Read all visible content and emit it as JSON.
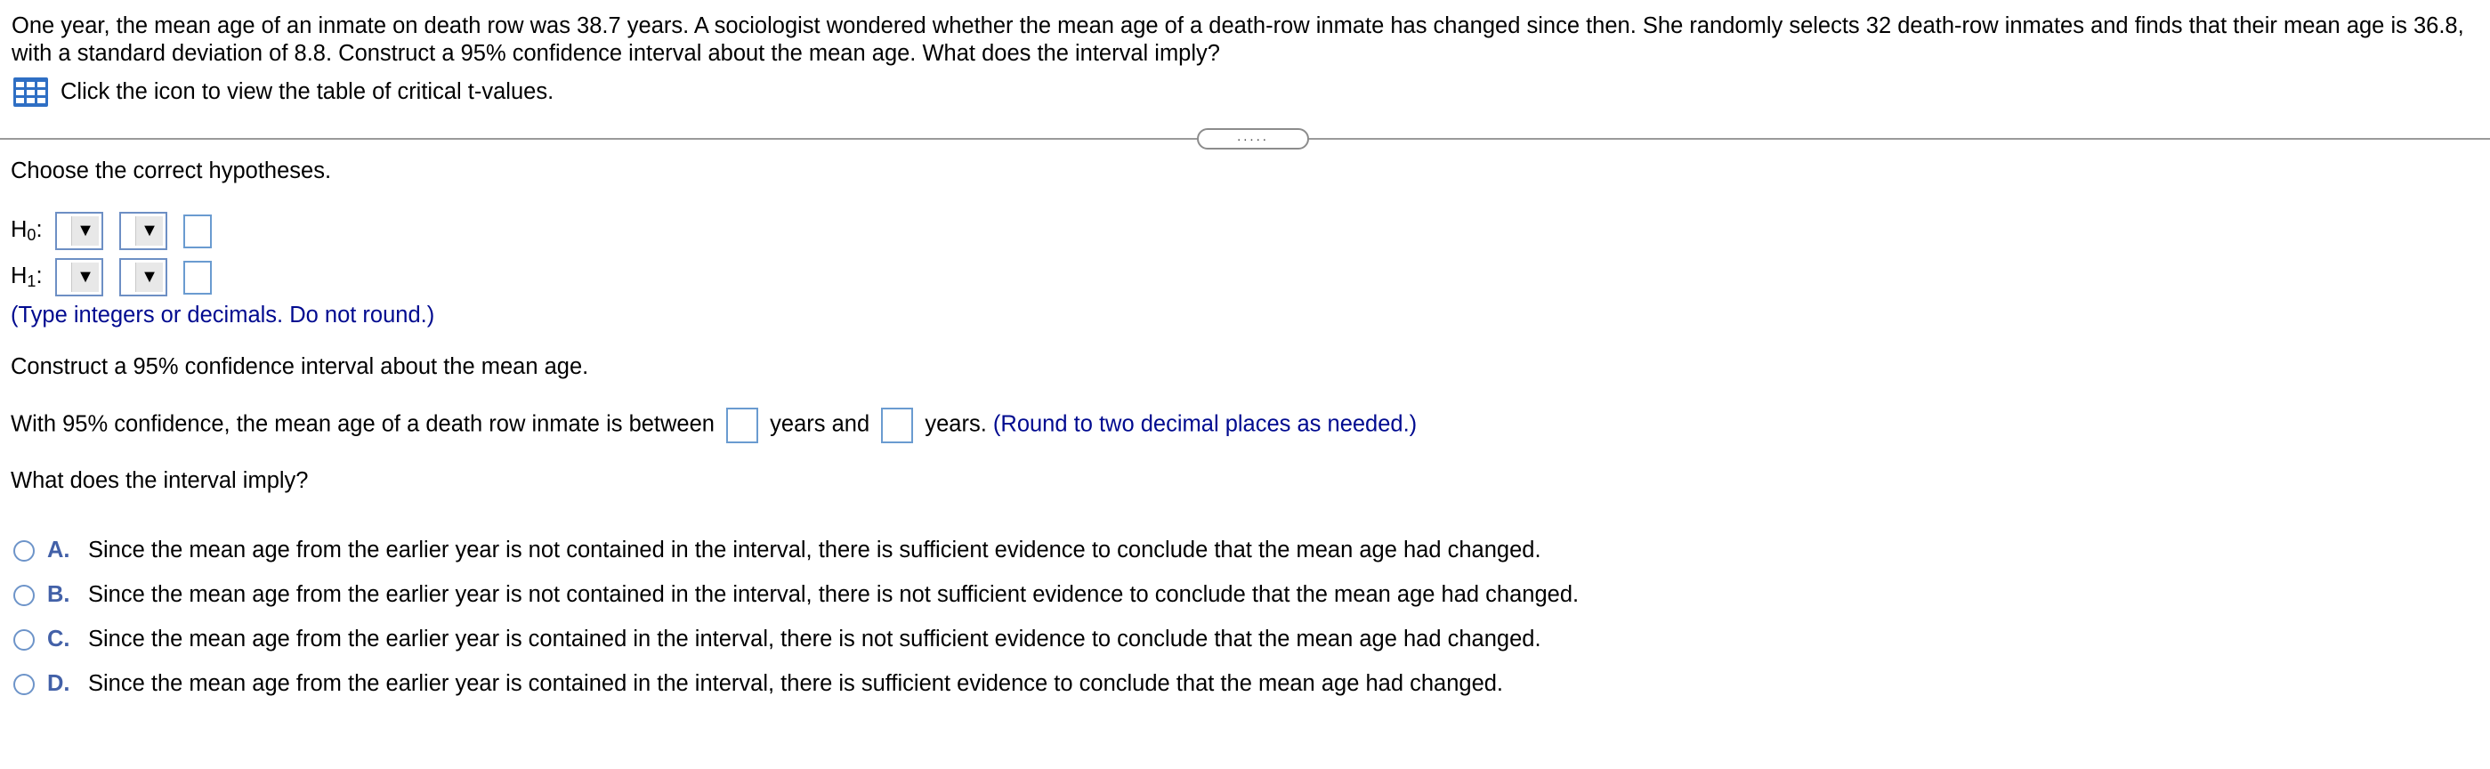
{
  "problem": {
    "text": "One year, the mean age of an inmate on death row was 38.7 years. A sociologist wondered whether the mean age of a death-row inmate has changed since then. She randomly selects 32 death-row inmates and finds that their mean age is 36.8, with a standard deviation of 8.8. Construct a 95% confidence interval about the mean age. What does the interval imply?"
  },
  "table_link": {
    "label": "Click the icon to view the table of critical t-values.",
    "icon": "table-grid-icon"
  },
  "divider_handle": ".....",
  "hypotheses": {
    "prompt": "Choose the correct hypotheses.",
    "h0_label": "H",
    "h0_sub": "0",
    "h1_label": "H",
    "h1_sub": "1",
    "colon": ":",
    "dropdown_arrow": "▼",
    "note": "(Type integers or decimals. Do not round.)"
  },
  "interval": {
    "prompt": "Construct a 95% confidence interval about the mean age.",
    "sentence_start": "With 95% confidence, the mean age of a death row inmate is between",
    "middle": "years and",
    "end": "years.",
    "note": "(Round to two decimal places as needed.)"
  },
  "implication": {
    "prompt": "What does the interval imply?",
    "choices": [
      {
        "letter": "A.",
        "text": "Since the mean age from the earlier year is not contained in the interval, there is sufficient evidence to conclude that the mean age had changed."
      },
      {
        "letter": "B.",
        "text": "Since the mean age from the earlier year is not contained in the interval, there is not sufficient evidence to conclude that the mean age had changed."
      },
      {
        "letter": "C.",
        "text": "Since the mean age from the earlier year is contained in the interval, there is not sufficient evidence to conclude that the mean age had changed."
      },
      {
        "letter": "D.",
        "text": "Since the mean age from the earlier year is contained in the interval, there is sufficient evidence to conclude that the mean age had changed."
      }
    ]
  },
  "colors": {
    "accent_blue": "#000a8f",
    "letter_blue": "#4361a8",
    "input_border": "#6a9bd0"
  }
}
